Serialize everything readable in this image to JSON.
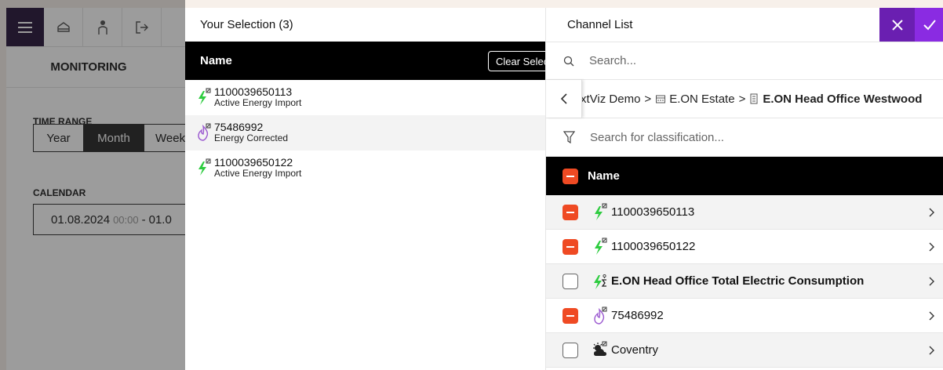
{
  "background_app": {
    "tab_label": "MONITORING",
    "time_range_label": "TIME RANGE",
    "range_options": [
      "Year",
      "Month",
      "Week"
    ],
    "range_selected": "Month",
    "calendar_label": "CALENDAR",
    "calendar_start_date": "01.08.2024",
    "calendar_start_time": "00:00",
    "calendar_separator": "-",
    "calendar_end_partial": "01.0"
  },
  "selection_panel": {
    "title": "Your Selection (3)",
    "header_name": "Name",
    "clear_button": "Clear Selection",
    "items": [
      {
        "id": "1100039650113",
        "subtitle": "Active Energy Import",
        "icon": "electricity-bolt-icon"
      },
      {
        "id": "75486992",
        "subtitle": "Energy Corrected",
        "icon": "gas-flame-icon"
      },
      {
        "id": "1100039650122",
        "subtitle": "Active Energy Import",
        "icon": "electricity-bolt-icon"
      }
    ]
  },
  "channel_panel": {
    "title": "Channel List",
    "search_placeholder": "Search...",
    "breadcrumb": [
      "xtViz Demo",
      "E.ON Estate",
      "E.ON Head Office Westwood"
    ],
    "breadcrumb_separator": ">",
    "classification_placeholder": "Search for classification...",
    "header_name": "Name",
    "items": [
      {
        "label": "1100039650113",
        "checked": true,
        "icon": "electricity-bolt-icon",
        "bold": false
      },
      {
        "label": "1100039650122",
        "checked": true,
        "icon": "electricity-bolt-icon",
        "bold": false
      },
      {
        "label": "E.ON Head Office Total Electric Consumption",
        "checked": false,
        "icon": "electricity-sum-icon",
        "bold": true
      },
      {
        "label": "75486992",
        "checked": true,
        "icon": "gas-flame-icon",
        "bold": false
      },
      {
        "label": "Coventry",
        "checked": false,
        "icon": "weather-icon",
        "bold": false
      }
    ]
  },
  "colors": {
    "accent_purple": "#6a1fb1",
    "accent_purple_light": "#8a2be2",
    "checkbox_orange": "#ef4a23",
    "electric_green": "#2ecc40",
    "gas_purple": "#9b59d0"
  }
}
